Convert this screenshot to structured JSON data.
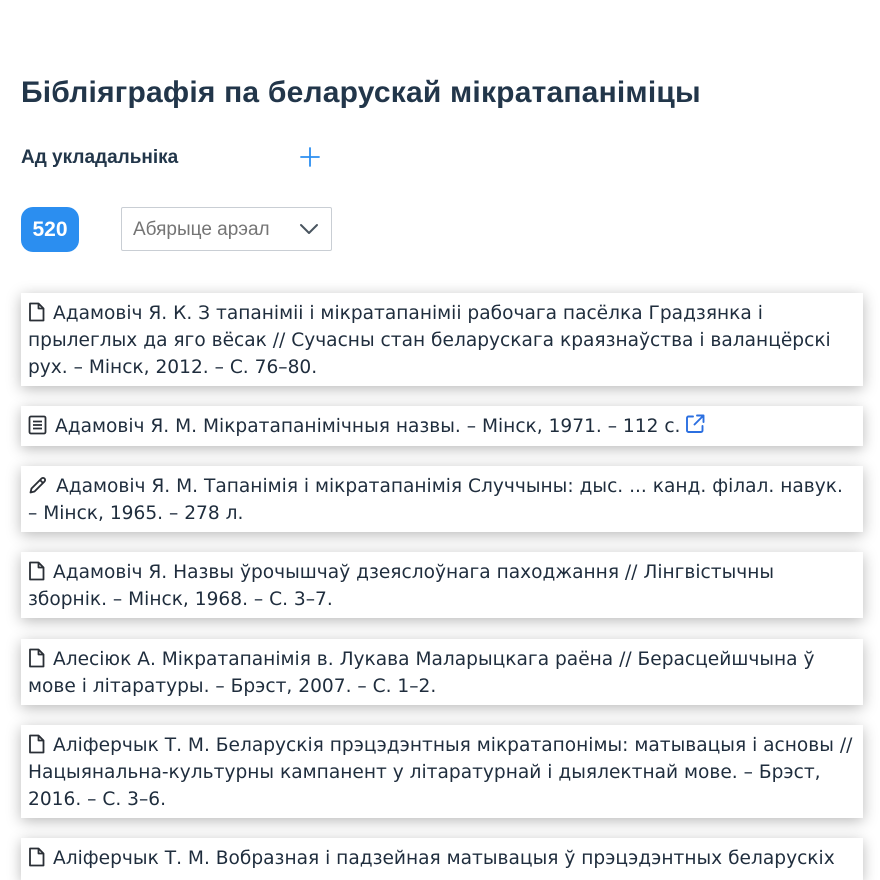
{
  "header": {
    "title": "Бібліяграфія па беларускай мікратапаніміцы",
    "compiler_label": "Ад укладальніка"
  },
  "filters": {
    "count": "520",
    "area_placeholder": "Абярыце арэал"
  },
  "colors": {
    "accent": "#2b8ef0",
    "heading": "#22364a",
    "text": "#1f2d3d"
  },
  "entries": [
    {
      "icon": "document-icon",
      "text": "Адамовіч Я. К. З тапаніміі і мікратапаніміі рабочага пасёлка Градзянка і прылеглых да яго вёсак // Сучасны стан беларускага краязнаўства і валанцёрскі рух. – Мінск, 2012. – С. 76–80."
    },
    {
      "icon": "book-icon",
      "text": "Адамовіч Я. М. Мікратапанімічныя назвы. – Мінск, 1971. – 112 с.",
      "link": "external-link-icon"
    },
    {
      "icon": "pencil-icon",
      "text": "Адамовіч Я. М. Тапанімія і мікратапанімія Случчыны: дыс. ... канд. філал. навук. – Мінск, 1965. – 278 л."
    },
    {
      "icon": "document-icon",
      "text": "Адамовіч Я. Назвы ўрочышчаў дзеяслоўнага паходжання // Лінгвістычны зборнік. – Мінск, 1968. – С. 3–7."
    },
    {
      "icon": "document-icon",
      "text": "Алесіюк А. Мікратапанімія в. Лукава Маларыцкага раёна // Берасцейшчына ў мове і літаратуры. – Брэст, 2007. – С. 1–2."
    },
    {
      "icon": "document-icon",
      "text": "Аліферчык Т. М. Беларускія прэцэдэнтныя мікратапонімы: матывацыя і асновы // Нацыянальна-культурны кампанент у літаратурнай і дыялектнай мове. – Брэст, 2016. – С. 3–6."
    },
    {
      "icon": "document-icon",
      "text": "Аліферчык Т. М. Вобразная і падзейная матывацыя ў прэцэдэнтных беларускіх"
    }
  ]
}
